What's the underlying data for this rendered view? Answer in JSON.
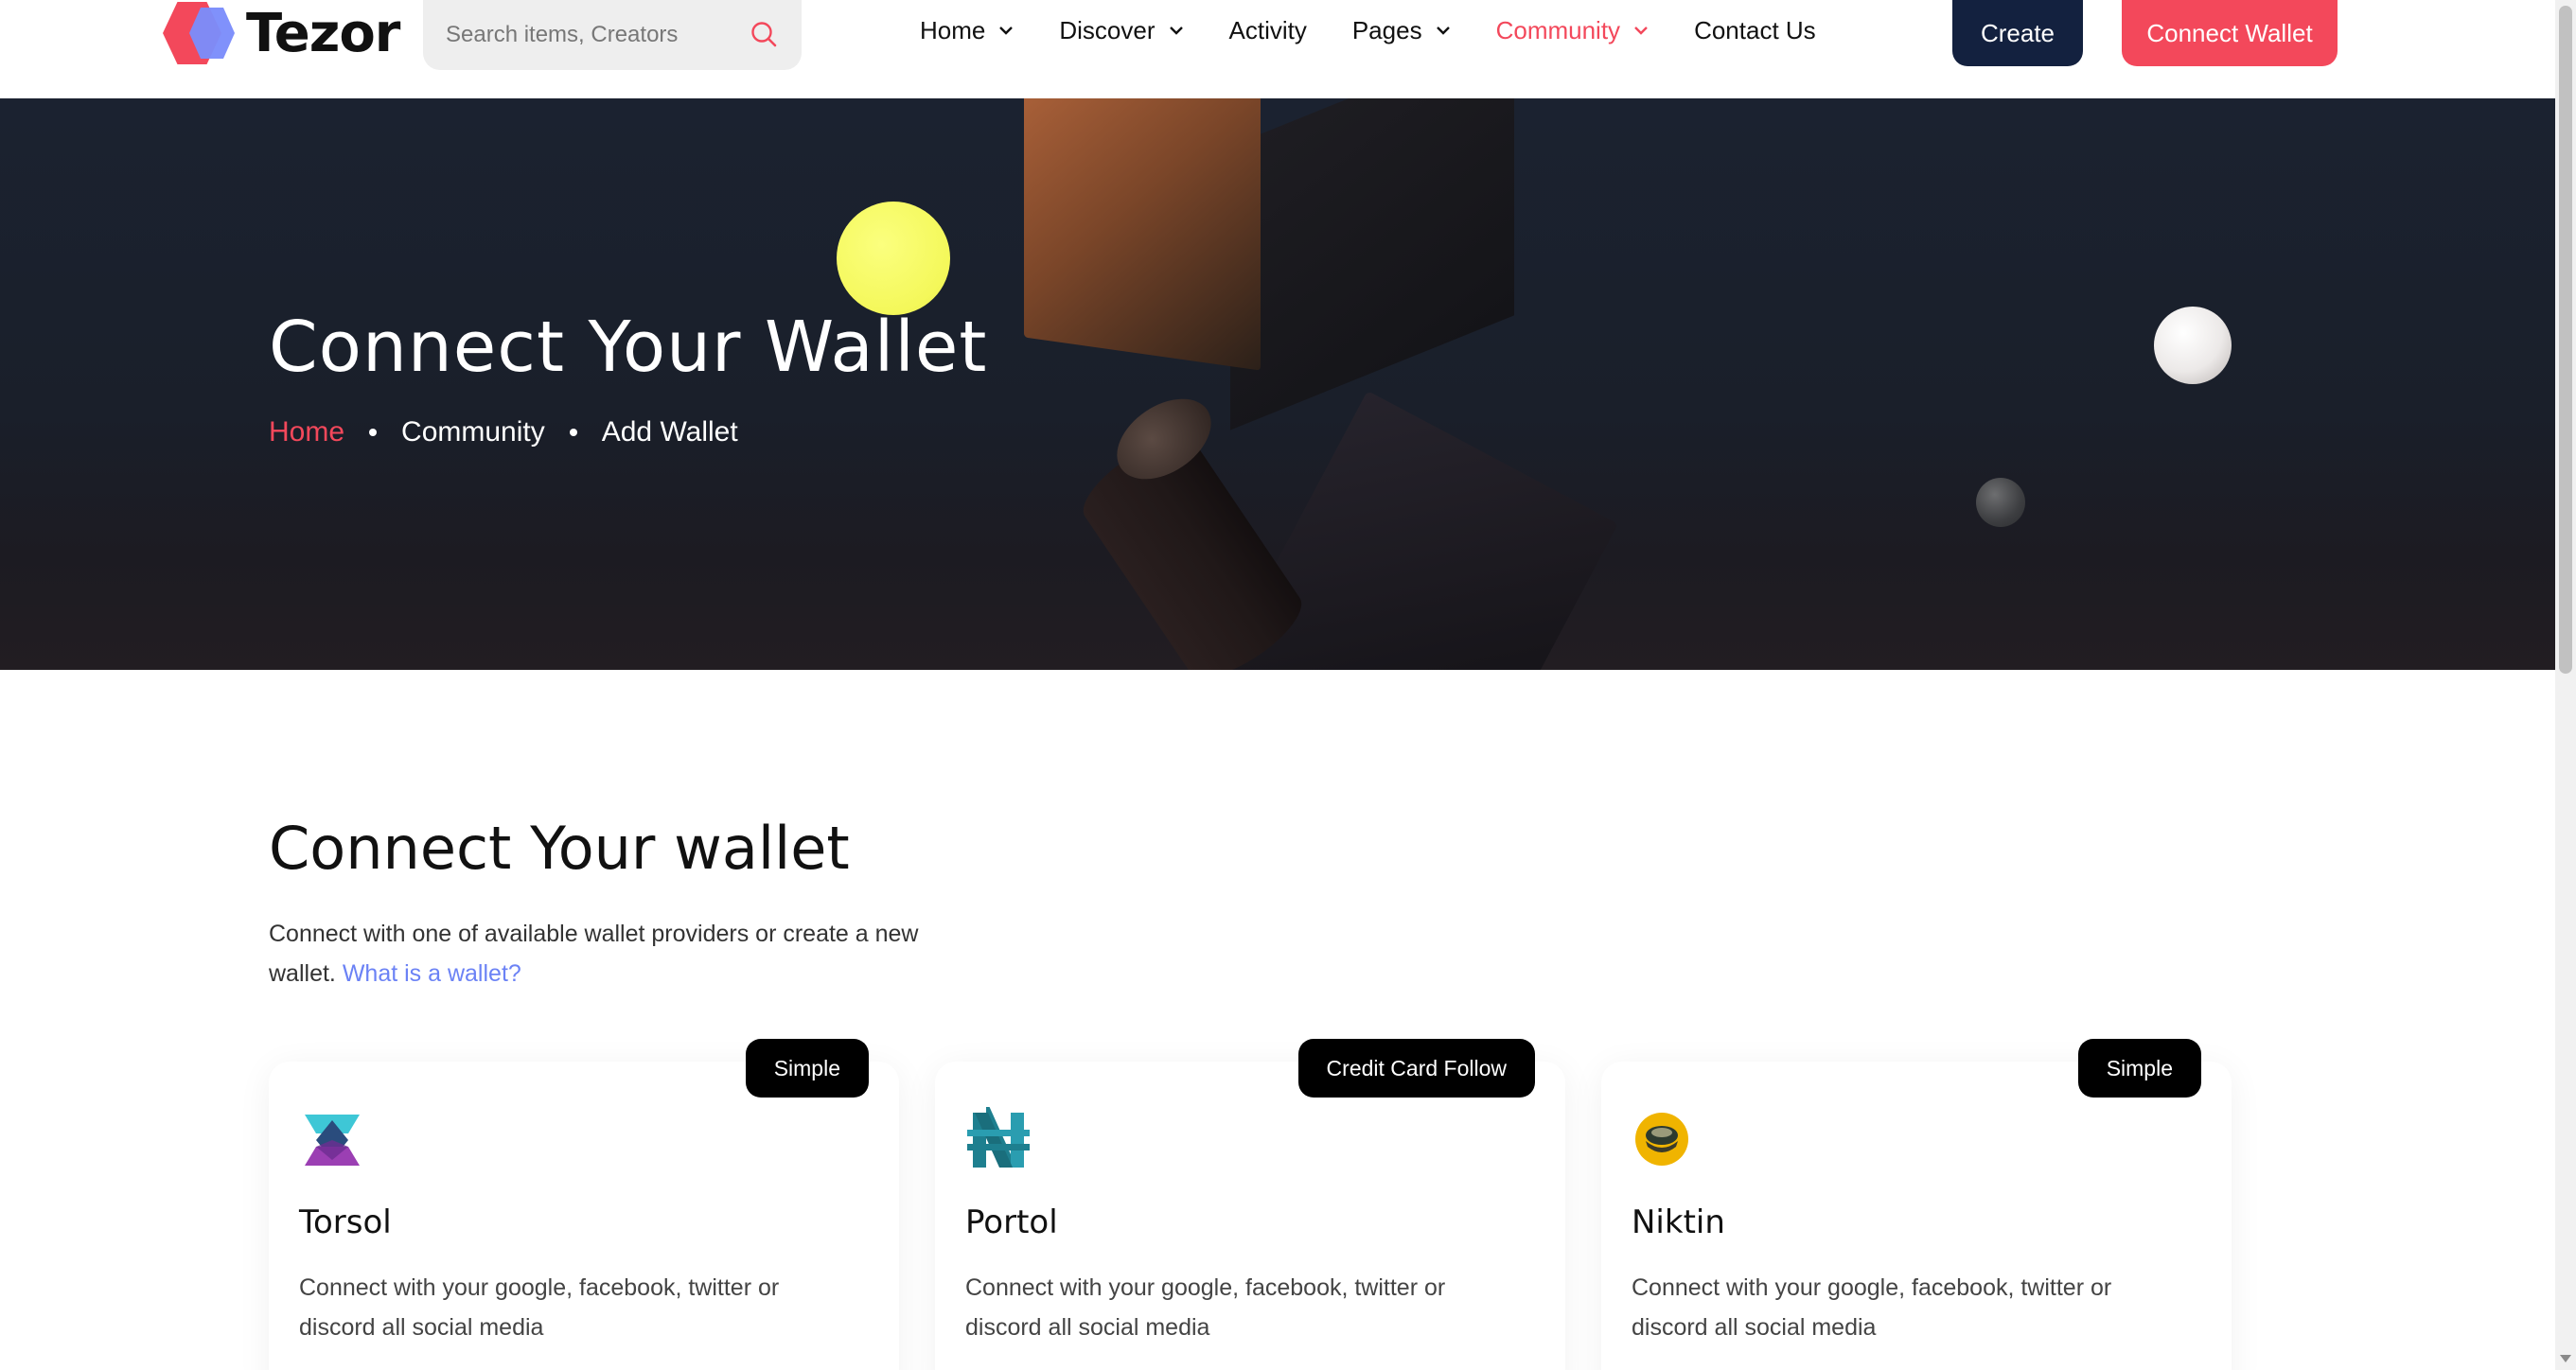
{
  "header": {
    "logo_text": "Tezor",
    "search_placeholder": "Search items, Creators",
    "nav": [
      {
        "label": "Home",
        "has_dropdown": true
      },
      {
        "label": "Discover",
        "has_dropdown": true
      },
      {
        "label": "Activity",
        "has_dropdown": false
      },
      {
        "label": "Pages",
        "has_dropdown": true
      },
      {
        "label": "Community",
        "has_dropdown": true,
        "active": true
      },
      {
        "label": "Contact Us",
        "has_dropdown": false
      }
    ],
    "create_label": "Create",
    "connect_label": "Connect Wallet"
  },
  "hero": {
    "title": "Connect Your Wallet",
    "breadcrumb": [
      "Home",
      "Community",
      "Add Wallet"
    ]
  },
  "section": {
    "title": "Connect Your wallet",
    "desc": "Connect with one of available wallet providers or create a new wallet.",
    "link": "What is a wallet?"
  },
  "cards": [
    {
      "badge": "Simple",
      "name": "Torsol",
      "desc": "Connect with your google, facebook, twitter or discord all social media",
      "icon": "torsol-logo-icon"
    },
    {
      "badge": "Credit Card Follow",
      "name": "Portol",
      "desc": "Connect with your google, facebook, twitter or discord all social media",
      "icon": "portol-logo-icon"
    },
    {
      "badge": "Simple",
      "name": "Niktin",
      "desc": "Connect with your google, facebook, twitter or discord all social media",
      "icon": "niktin-logo-icon"
    }
  ],
  "colors": {
    "accent": "#f3485b",
    "navy": "#13213f",
    "link": "#6b82f5"
  }
}
